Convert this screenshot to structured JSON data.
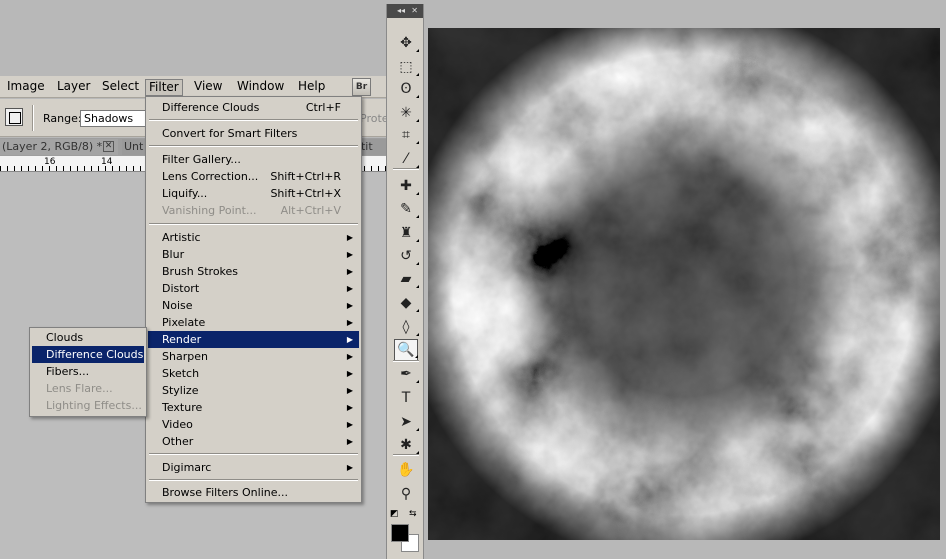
{
  "menubar": {
    "items": [
      "Image",
      "Layer",
      "Select",
      "Filter",
      "View",
      "Window",
      "Help"
    ],
    "active": "Filter",
    "bridge_button": "Br"
  },
  "options_bar": {
    "range_label": "Range:",
    "range_value": "Shadows",
    "protect_partial": "Prote"
  },
  "doc_tabs": {
    "tab1": "(Layer 2, RGB/8) *",
    "tab2": "Unt",
    "tab3": "ntit",
    "close_glyph": "✕"
  },
  "ruler": {
    "labels": [
      "16",
      "14"
    ]
  },
  "filter_menu": {
    "last_filter": {
      "label": "Difference Clouds",
      "shortcut": "Ctrl+F"
    },
    "convert_smart": "Convert for Smart Filters",
    "group1": [
      {
        "label": "Filter Gallery...",
        "shortcut": "",
        "disabled": false
      },
      {
        "label": "Lens Correction...",
        "shortcut": "Shift+Ctrl+R",
        "disabled": false
      },
      {
        "label": "Liquify...",
        "shortcut": "Shift+Ctrl+X",
        "disabled": false
      },
      {
        "label": "Vanishing Point...",
        "shortcut": "Alt+Ctrl+V",
        "disabled": true
      }
    ],
    "submenus": [
      "Artistic",
      "Blur",
      "Brush Strokes",
      "Distort",
      "Noise",
      "Pixelate",
      "Render",
      "Sharpen",
      "Sketch",
      "Stylize",
      "Texture",
      "Video",
      "Other"
    ],
    "highlighted": "Render",
    "digimarc": "Digimarc",
    "browse_online": "Browse Filters Online..."
  },
  "render_submenu": {
    "items": [
      {
        "label": "Clouds",
        "disabled": false
      },
      {
        "label": "Difference Clouds",
        "disabled": false
      },
      {
        "label": "Fibers...",
        "disabled": false
      },
      {
        "label": "Lens Flare...",
        "disabled": true
      },
      {
        "label": "Lighting Effects...",
        "disabled": true
      }
    ],
    "highlighted": "Difference Clouds"
  },
  "toolbox": {
    "collapse_glyph": "◂◂",
    "close_glyph": "✕",
    "tools": [
      {
        "name": "move-tool-icon",
        "glyph": "✥"
      },
      {
        "name": "marquee-tool-icon",
        "glyph": "⬚"
      },
      {
        "name": "lasso-tool-icon",
        "glyph": "ʘ"
      },
      {
        "name": "magic-wand-tool-icon",
        "glyph": "✳"
      },
      {
        "name": "crop-tool-icon",
        "glyph": "⌗"
      },
      {
        "name": "eyedropper-tool-icon",
        "glyph": "⁄"
      },
      {
        "name": "healing-brush-tool-icon",
        "glyph": "✚"
      },
      {
        "name": "brush-tool-icon",
        "glyph": "✎"
      },
      {
        "name": "clone-stamp-tool-icon",
        "glyph": "♜"
      },
      {
        "name": "history-brush-tool-icon",
        "glyph": "↺"
      },
      {
        "name": "eraser-tool-icon",
        "glyph": "▰"
      },
      {
        "name": "paint-bucket-tool-icon",
        "glyph": "◆"
      },
      {
        "name": "blur-tool-icon",
        "glyph": "◊"
      },
      {
        "name": "dodge-tool-icon",
        "glyph": "🔍"
      },
      {
        "name": "pen-tool-icon",
        "glyph": "✒"
      },
      {
        "name": "type-tool-icon",
        "glyph": "T"
      },
      {
        "name": "path-selection-tool-icon",
        "glyph": "➤"
      },
      {
        "name": "custom-shape-tool-icon",
        "glyph": "✱"
      },
      {
        "name": "hand-tool-icon",
        "glyph": "✋"
      },
      {
        "name": "zoom-tool-icon",
        "glyph": "⚲"
      }
    ],
    "selected_tool": "dodge-tool-icon",
    "foreground_color": "#000000",
    "background_color": "#ffffff"
  }
}
